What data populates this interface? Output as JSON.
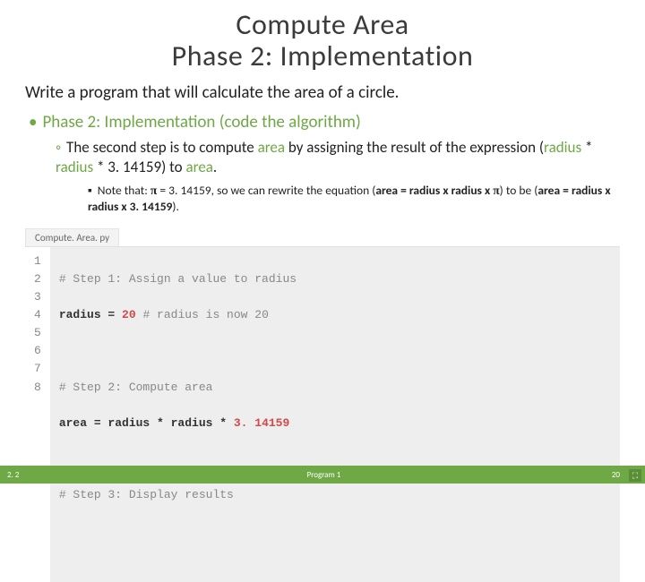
{
  "title": {
    "line1": "Compute Area",
    "line2": "Phase 2: Implementation"
  },
  "intro": "Write a program that will calculate the area of a circle.",
  "bullet1": "Phase 2: Implementation (code the algorithm)",
  "bullet2": {
    "pre": "The second step is to compute ",
    "kw1": "area",
    "mid1": " by assigning the result of the expression (",
    "kw2": "radius",
    "mid2": " * ",
    "kw3": "radius",
    "mid3": " * 3. 14159) to ",
    "kw4": "area",
    "end": "."
  },
  "bullet3": {
    "pre": "Note that: ",
    "pi": "π",
    "mid1": " = 3. 14159, so we can rewrite the equation (",
    "b1": "area = radius x radius x ",
    "pi2": "π",
    "mid2": ") to be (",
    "b2": "area = radius x radius x 3. 14159",
    "end": ")."
  },
  "codeTab": "Compute. Area. py",
  "gutter": [
    "1",
    "2",
    "3",
    "4",
    "5",
    "6",
    "7",
    "8"
  ],
  "code": {
    "l1c": "# Step 1: Assign a value to radius",
    "l2a": "radius = ",
    "l2n": "20",
    "l2c": " # radius is now 20",
    "l4c": "# Step 2: Compute area",
    "l5": "area = radius * radius * ",
    "l5n": "3. 14159",
    "l7c": "# Step 3: Display results"
  },
  "footer": {
    "left": "2. 2",
    "center": "Program 1",
    "right": "20"
  }
}
